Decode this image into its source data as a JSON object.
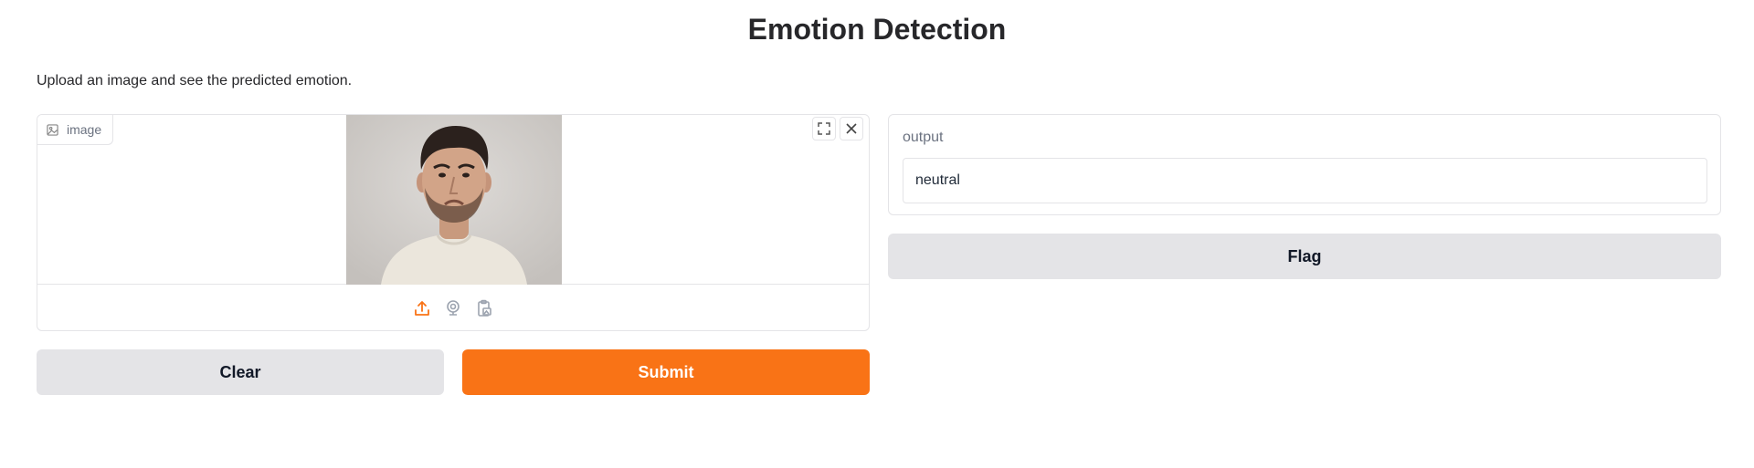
{
  "page": {
    "title": "Emotion Detection",
    "description": "Upload an image and see the predicted emotion."
  },
  "input": {
    "label": "image",
    "image_alt": "man with sad expression",
    "sources": [
      "upload-icon",
      "webcam-icon",
      "clipboard-icon"
    ],
    "controls": [
      "fullscreen-icon",
      "close-icon"
    ]
  },
  "output": {
    "label": "output",
    "value": "neutral"
  },
  "buttons": {
    "clear": "Clear",
    "submit": "Submit",
    "flag": "Flag"
  },
  "colors": {
    "accent": "#f97316",
    "secondary_button": "#e4e4e7",
    "border": "#e4e4e7"
  }
}
